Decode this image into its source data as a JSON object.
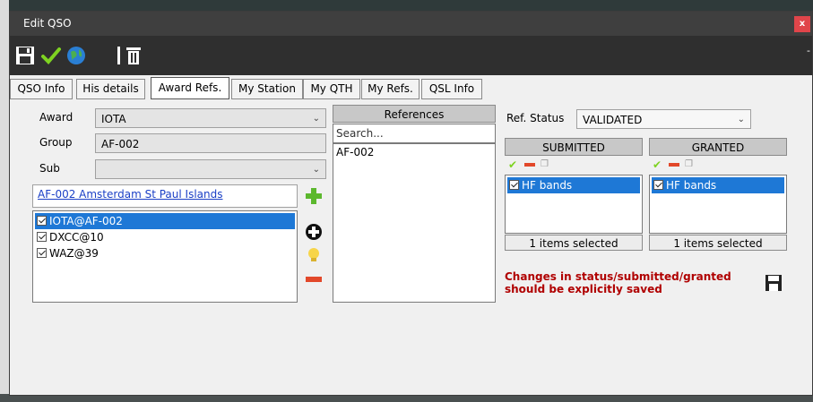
{
  "window": {
    "title": "Edit QSO",
    "close": "x",
    "minimize": "-"
  },
  "toolbar": {
    "icons": [
      "save-icon",
      "check-icon",
      "globe-icon",
      "trash-icon"
    ]
  },
  "tabs": [
    "QSO Info",
    "His details",
    "Award Refs.",
    "My Station",
    "My QTH",
    "My Refs.",
    "QSL Info"
  ],
  "active_tab": "Award Refs.",
  "form": {
    "award_label": "Award",
    "award_value": "IOTA",
    "group_label": "Group",
    "group_value": "AF-002",
    "sub_label": "Sub",
    "sub_value": ""
  },
  "ref_link": "AF-002 Amsterdam  St Paul Islands",
  "award_list": [
    "IOTA@AF-002",
    "DXCC@10",
    "WAZ@39"
  ],
  "references": {
    "header": "References",
    "search_placeholder": "Search...",
    "items": [
      "AF-002"
    ]
  },
  "ref_status": {
    "label": "Ref. Status",
    "value": "VALIDATED"
  },
  "submitted": {
    "header": "SUBMITTED",
    "items": [
      "HF bands"
    ],
    "footer": "1 items selected"
  },
  "granted": {
    "header": "GRANTED",
    "items": [
      "HF bands"
    ],
    "footer": "1 items selected"
  },
  "warning": "Changes in status/submitted/granted should be explicitly saved",
  "colors": {
    "titlebar": "#3f3f3f",
    "toolbar": "#2f2f2f",
    "selection": "#1e78d6",
    "warning": "#b00000",
    "link": "#1a3fc6"
  }
}
